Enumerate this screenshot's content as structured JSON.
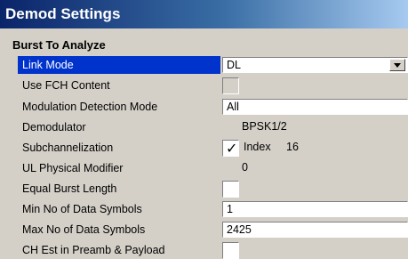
{
  "window": {
    "title": "Demod Settings"
  },
  "section": {
    "title": "Burst To Analyze"
  },
  "rows": {
    "link_mode": {
      "label": "Link Mode",
      "value": "DL"
    },
    "use_fch": {
      "label": "Use FCH Content",
      "checked": false,
      "enabled": false
    },
    "mod_detect": {
      "label": "Modulation Detection Mode",
      "value": "All"
    },
    "demodulator": {
      "label": "Demodulator",
      "value": "BPSK1/2"
    },
    "subchannelization": {
      "label": "Subchannelization",
      "checked": true,
      "index_label": "Index",
      "index_value": "16"
    },
    "ul_modifier": {
      "label": "UL Physical Modifier",
      "value": "0"
    },
    "equal_burst": {
      "label": "Equal Burst Length",
      "checked": false
    },
    "min_data": {
      "label": "Min No of Data Symbols",
      "value": "1"
    },
    "max_data": {
      "label": "Max No of Data Symbols",
      "value": "2425"
    },
    "ch_est": {
      "label": "CH Est in Preamb & Payload",
      "checked": false
    }
  },
  "colors": {
    "title_gradient_start": "#0a246a",
    "selection": "#0033cc",
    "panel": "#d4d0c8"
  }
}
